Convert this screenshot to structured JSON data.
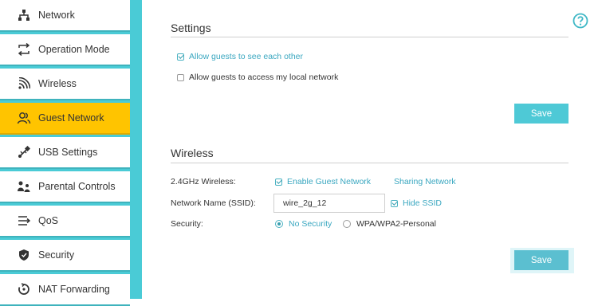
{
  "sidebar": {
    "items": [
      {
        "label": "Network",
        "icon": "network-icon",
        "active": false
      },
      {
        "label": "Operation Mode",
        "icon": "operation-mode-icon",
        "active": false
      },
      {
        "label": "Wireless",
        "icon": "wireless-icon",
        "active": false
      },
      {
        "label": "Guest Network",
        "icon": "guest-network-icon",
        "active": true
      },
      {
        "label": "USB Settings",
        "icon": "usb-icon",
        "active": false
      },
      {
        "label": "Parental Controls",
        "icon": "parental-controls-icon",
        "active": false
      },
      {
        "label": "QoS",
        "icon": "qos-icon",
        "active": false
      },
      {
        "label": "Security",
        "icon": "shield-icon",
        "active": false
      },
      {
        "label": "NAT Forwarding",
        "icon": "nat-forwarding-icon",
        "active": false
      }
    ]
  },
  "help": {
    "icon": "help-icon"
  },
  "settings": {
    "title": "Settings",
    "allow_guests_see_each_other": {
      "label": "Allow guests to see each other",
      "checked": true
    },
    "allow_guests_local_network": {
      "label": "Allow guests to access my local network",
      "checked": false
    },
    "save_label": "Save"
  },
  "wireless": {
    "title": "Wireless",
    "band_label": "2.4GHz Wireless:",
    "enable_guest_network": {
      "label": "Enable Guest Network",
      "checked": true
    },
    "sharing_network_label": "Sharing Network",
    "ssid_label": "Network Name (SSID):",
    "ssid_value": "wire_2g_12",
    "hide_ssid": {
      "label": "Hide SSID",
      "checked": true
    },
    "security_label": "Security:",
    "security_options": [
      {
        "label": "No Security",
        "selected": true
      },
      {
        "label": "WPA/WPA2-Personal",
        "selected": false
      }
    ],
    "save_label": "Save"
  },
  "colors": {
    "accent": "#4ec9d6",
    "sidebar_bg": "#4acbd6",
    "active_item": "#ffc400",
    "link": "#3aa7c0"
  }
}
